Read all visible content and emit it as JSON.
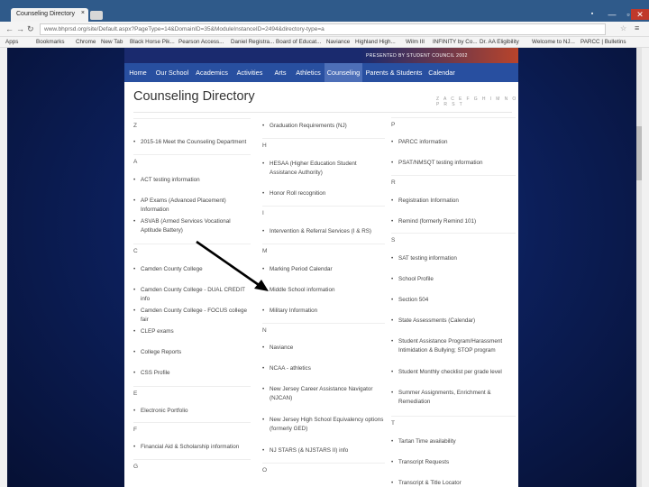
{
  "browser": {
    "tab_title": "Counseling Directory",
    "tab_close": "×",
    "url": "www.bhprsd.org/site/Default.aspx?PageType=14&DomainID=35&ModuleInstanceID=2494&directory-type=a",
    "bookmarks": [
      "Apps",
      "Bookmarks",
      "Chrome",
      "New Tab",
      "Black Horse Pik...",
      "Pearson Access...",
      "Daniel Registra...",
      "Board of Educat...",
      "Naviance",
      "Highland High...",
      "Wilm III",
      "INFINITY by Co...",
      "Dr. AA Eligibility",
      "Welcome to NJ...",
      "PARCC | Bulletins"
    ]
  },
  "site": {
    "banner_text": "PRESENTED BY STUDENT COUNCIL 2002",
    "nav": [
      "Home",
      "Our School",
      "Academics",
      "Activities",
      "Arts",
      "Athletics",
      "Counseling",
      "Parents & Students",
      "Calendar"
    ],
    "active_nav": "Counseling",
    "page_title": "Counseling Directory",
    "alpha_index": "Z A C E F G H I M N O P R S T"
  },
  "directory": {
    "col1": [
      {
        "letter": "Z"
      },
      {
        "item": "2015-16 Meet the Counseling Department"
      },
      {
        "letter": "A"
      },
      {
        "item": "ACT testing information"
      },
      {
        "item": "AP Exams (Advanced Placement) Information"
      },
      {
        "item": "ASVAB (Armed Services Vocational Aptitude Battery)"
      },
      {
        "letter": "C"
      },
      {
        "item": "Camden County College"
      },
      {
        "item": "Camden County College - DUAL CREDIT info"
      },
      {
        "item": "Camden County College - FOCUS college fair"
      },
      {
        "item": "CLEP exams"
      },
      {
        "item": "College Reports"
      },
      {
        "item": "CSS Profile"
      },
      {
        "letter": "E"
      },
      {
        "item": "Electronic Portfolio"
      },
      {
        "letter": "F"
      },
      {
        "item": "Financial Aid & Scholarship information"
      },
      {
        "letter": "G"
      }
    ],
    "col2": [
      {
        "item": "Graduation Requirements (NJ)"
      },
      {
        "letter": "H"
      },
      {
        "item": "HESAA (Higher Education Student Assistance Authority)"
      },
      {
        "item": "Honor Roll recognition"
      },
      {
        "letter": "I"
      },
      {
        "item": "Intervention & Referral Services (I & RS)"
      },
      {
        "letter": "M"
      },
      {
        "item": "Marking Period Calendar"
      },
      {
        "item": "Middle School information"
      },
      {
        "item": "Military Information"
      },
      {
        "letter": "N"
      },
      {
        "item": "Naviance"
      },
      {
        "item": "NCAA - athletics"
      },
      {
        "item": "New Jersey Career Assistance Navigator (NJCAN)"
      },
      {
        "item": "New Jersey High School Equivalency options (formerly GED)"
      },
      {
        "item": "NJ STARS (& NJSTARS II) info"
      },
      {
        "letter": "O"
      }
    ],
    "col3": [
      {
        "letter": "P"
      },
      {
        "item": "PARCC information"
      },
      {
        "item": "PSAT/NMSQT testing information"
      },
      {
        "letter": "R"
      },
      {
        "item": "Registration Information"
      },
      {
        "item": "Remind (formerly Remind 101)"
      },
      {
        "letter": "S"
      },
      {
        "item": "SAT testing information"
      },
      {
        "item": "School Profile"
      },
      {
        "item": "Section 504"
      },
      {
        "item": "State Assessments (Calendar)"
      },
      {
        "item": "Student Assistance Program/Harassment Intimidation & Bullying; STOP program"
      },
      {
        "item": "Student Monthly checklist per grade level"
      },
      {
        "item": "Summer Assignments, Enrichment & Remediation"
      },
      {
        "letter": "T"
      },
      {
        "item": "Tartan Time availability"
      },
      {
        "item": "Transcript Requests"
      },
      {
        "item": "Transcript & Title Locator"
      }
    ]
  },
  "colors": {
    "nav_bg": "#284fa0",
    "nav_active": "#4d6fb8",
    "page_bg": "#0c1f5a"
  }
}
